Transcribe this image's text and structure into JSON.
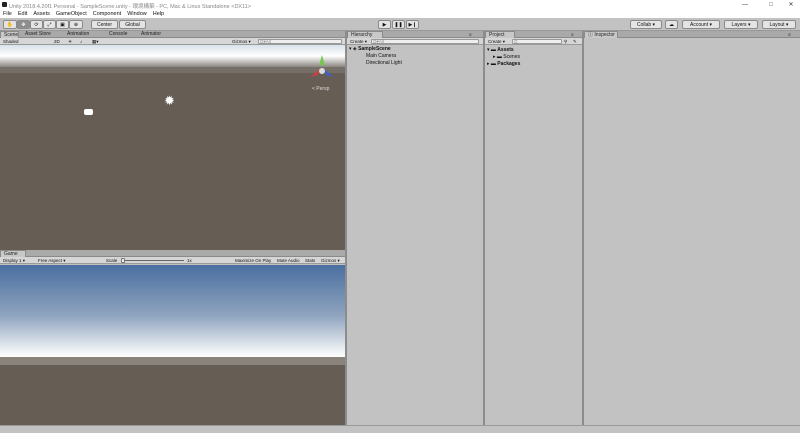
{
  "window": {
    "title": "Unity 2018.4.20f1 Personal - SampleScene.unity - 環境構築 - PC, Mac & Linux Standalone <DX11>",
    "minimize": "—",
    "maximize": "□",
    "close": "✕"
  },
  "menu": [
    "File",
    "Edit",
    "Assets",
    "GameObject",
    "Component",
    "Window",
    "Help"
  ],
  "toolbar": {
    "center_label": "Center",
    "global_label": "Global",
    "collab_label": "Collab ▾",
    "account_label": "Account ▾",
    "layers_label": "Layers ▾",
    "layout_label": "Layout ▾",
    "play": "▶",
    "pause": "❚❚",
    "step": "▶❙"
  },
  "scene": {
    "tabs": [
      "Scene",
      "Asset Store",
      "Animation",
      "Console",
      "Animator"
    ],
    "shading": "Shaded",
    "mode_2d": "2D",
    "gizmos": "Gizmos ▾",
    "search_placeholder": "Q▾All",
    "persp_label": "< Persp"
  },
  "game": {
    "tab": "Game",
    "display": "Display 1 ▾",
    "aspect": "Free Aspect ▾",
    "scale_label": "Scale",
    "scale_value": "1x",
    "maximize_on_play": "Maximize On Play",
    "mute_audio": "Mute Audio",
    "stats": "Stats",
    "gizmos": "Gizmos ▾"
  },
  "hierarchy": {
    "tab": "Hierarchy",
    "create": "Create ▾",
    "search_placeholder": "Q▾All",
    "scene_name": "SampleScene",
    "items": [
      "Main Camera",
      "Directional Light"
    ]
  },
  "project": {
    "tab": "Project",
    "create": "Create ▾",
    "search_placeholder": "Q",
    "assets": "Assets",
    "scenes": "Scenes",
    "packages": "Packages"
  },
  "inspector": {
    "tab": "Inspector"
  },
  "colors": {
    "editor_bg": "#c2c2c2",
    "scene_ground": "#665d55",
    "sky_top": "#4a6fa0",
    "play_active": "#8e8e8e"
  }
}
